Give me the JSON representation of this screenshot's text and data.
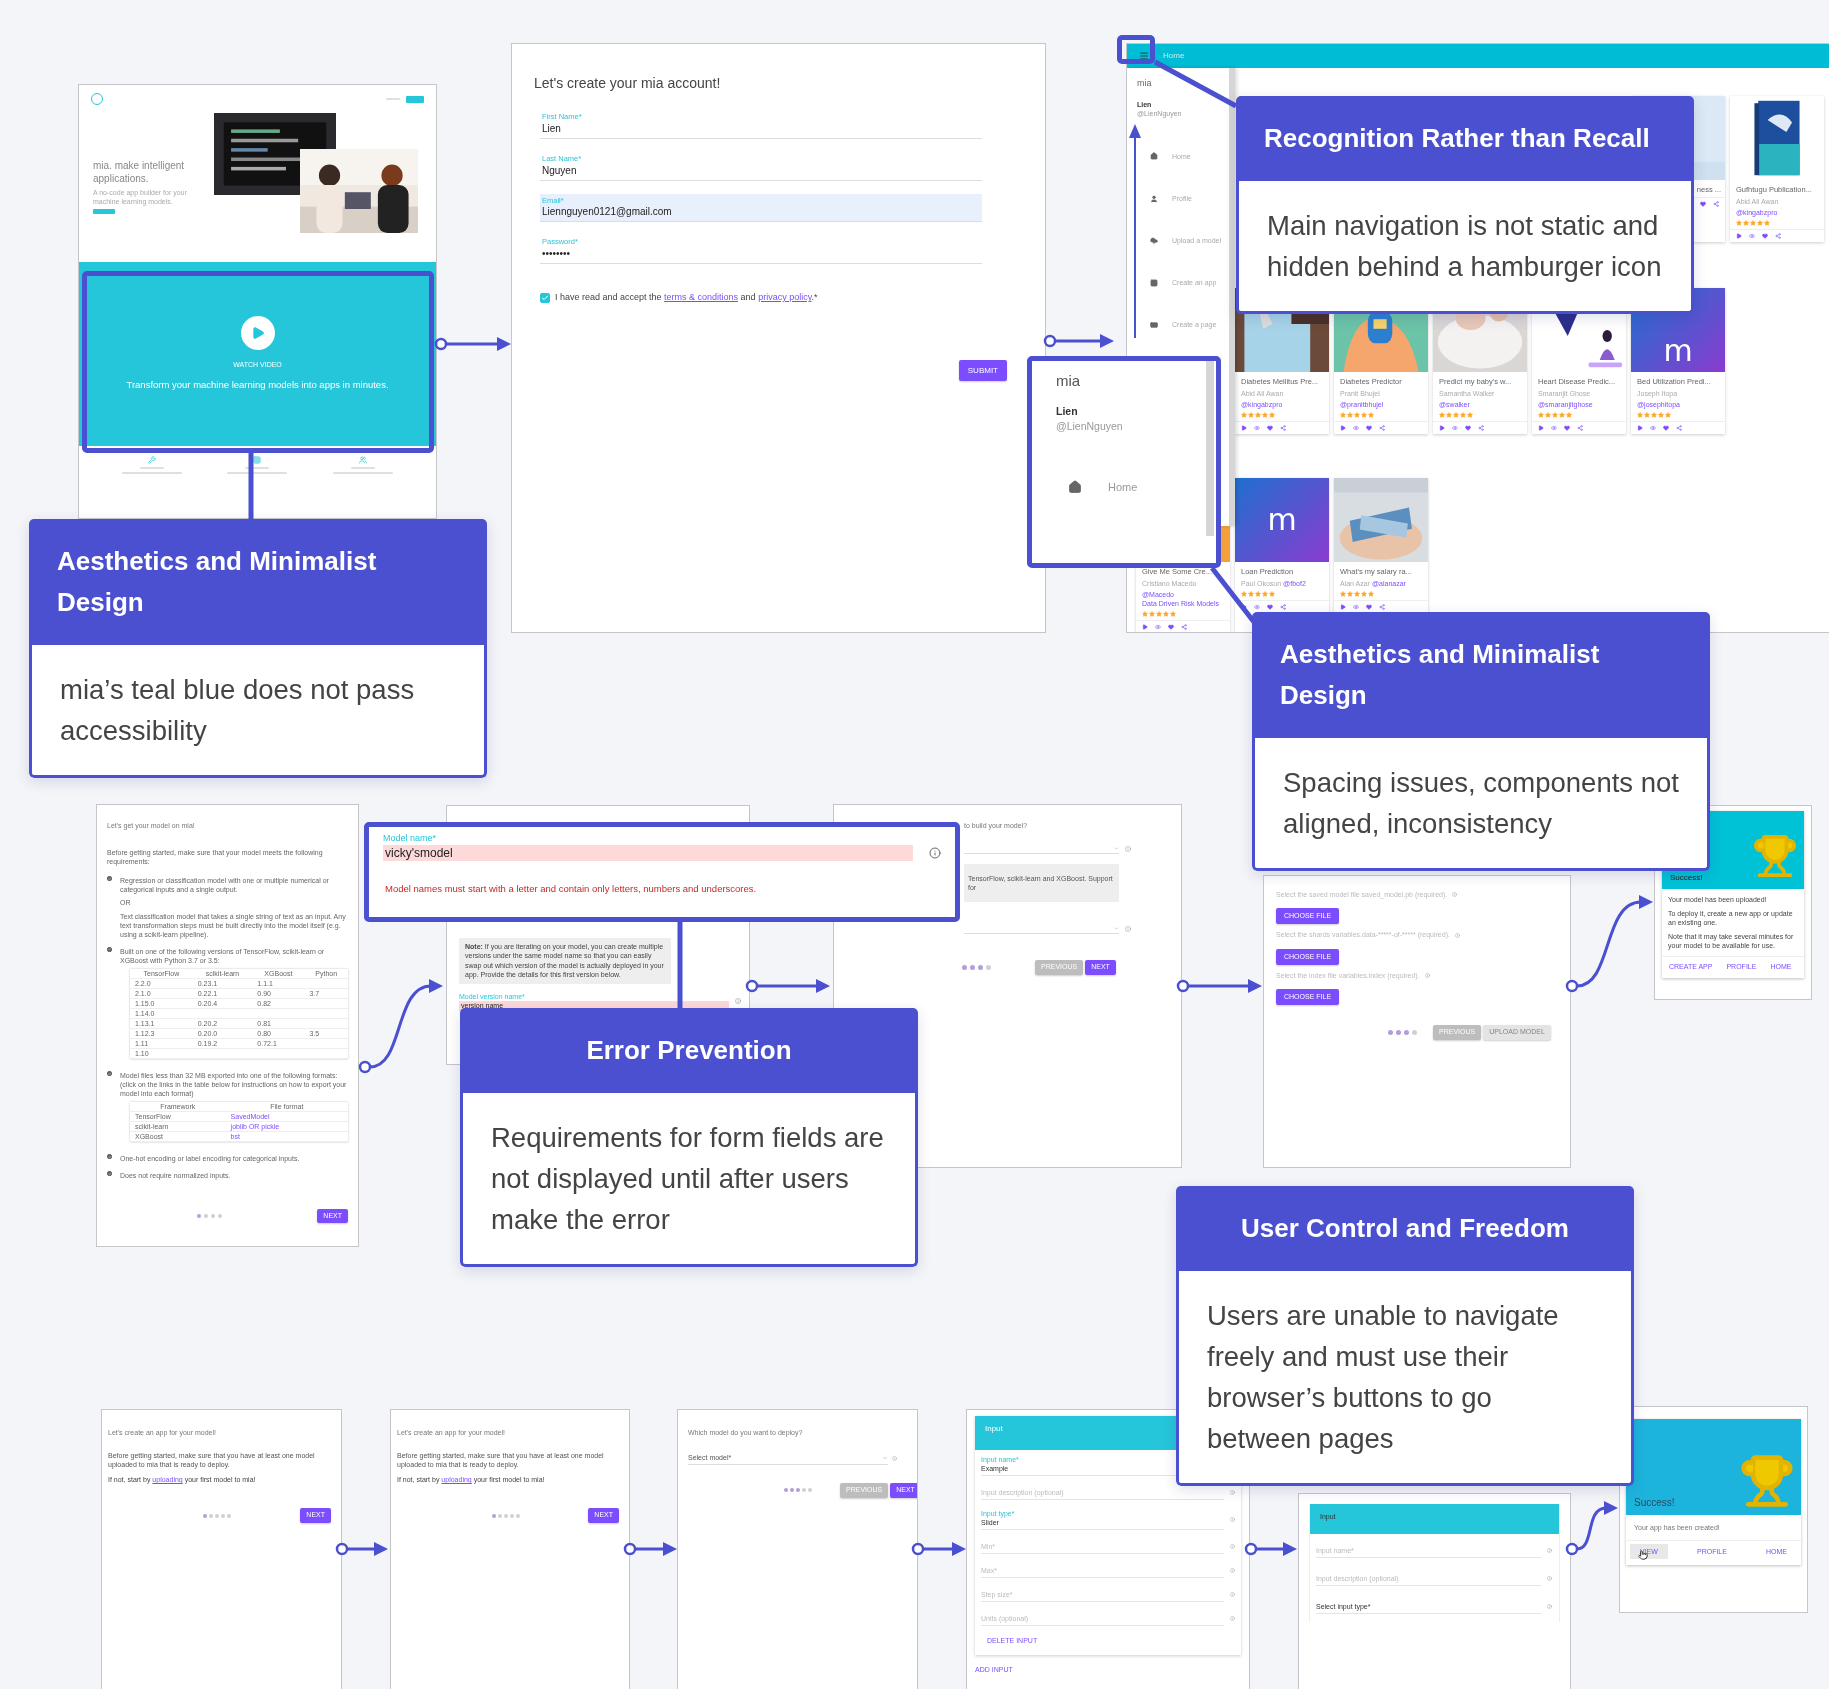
{
  "landing": {
    "headline": "mia. make intelligent applications.",
    "subline": "A no-code app builder for your machine learning models.",
    "video_label": "WATCH VIDEO",
    "video_caption": "Transform your machine learning models into apps in minutes."
  },
  "signup": {
    "title": "Let's create your mia account!",
    "fields": [
      {
        "label": "First Name*",
        "value": "Lien",
        "highlighted": false
      },
      {
        "label": "Last Name*",
        "value": "Nguyen",
        "highlighted": false
      },
      {
        "label": "Email*",
        "value": "Liennguyen0121@gmail.com",
        "highlighted": true
      },
      {
        "label": "Password*",
        "value": "••••••••",
        "highlighted": false
      }
    ],
    "consent": {
      "checked": true,
      "parts": [
        {
          "kind": "text",
          "text": "I have read and accept the "
        },
        {
          "kind": "link",
          "text": "terms & conditions"
        },
        {
          "kind": "text",
          "text": " and "
        },
        {
          "kind": "link",
          "text": "privacy policy"
        },
        {
          "kind": "text",
          "text": ".*"
        }
      ]
    },
    "submit": "SUBMIT"
  },
  "dashboard": {
    "page_title": "Home",
    "drawer": {
      "brand": "mia",
      "user_name": "Lien",
      "user_handle": "@LienNguyen",
      "items": [
        {
          "kind": "home",
          "label": "Home"
        },
        {
          "kind": "profile",
          "label": "Profile"
        },
        {
          "kind": "upload",
          "label": "Upload a model"
        },
        {
          "kind": "app",
          "label": "Create an app"
        },
        {
          "kind": "page",
          "label": "Create a page"
        }
      ]
    },
    "rows": [
      [
        "",
        "",
        "",
        "",
        "",
        {
          "kind": "picture",
          "title": "ness ..."
        },
        {
          "kind": "picture",
          "title": "Gufhtugu Publication...",
          "author": "Abid Ali Awan",
          "handle": "@kingabzpro",
          "stars": 5
        }
      ],
      [
        "",
        {
          "kind": "picture",
          "title": "Diabetes Mellitus Pre...",
          "author": "Abid Ali Awan",
          "handle": "@kingabzpro",
          "stars": 5
        },
        {
          "kind": "picture",
          "title": "Diabetes Predictor",
          "author": "Pranit Bhujel",
          "handle": "@pranitbhujel",
          "stars": 5
        },
        {
          "kind": "picture",
          "title": "Predict my baby's w...",
          "author": "Samantha Walker",
          "handle": "@swalker",
          "stars": 5
        },
        {
          "kind": "picture",
          "title": "Heart Disease Predic...",
          "author": "Smaranjit Ghose",
          "handle": "@smaranjitghose",
          "stars": 5
        },
        {
          "kind": "logo",
          "title": "Bed Utilization Predi...",
          "author": "Joseph Itopa",
          "handle": "@josephitopa",
          "logo_text": "m",
          "stars": 5
        }
      ],
      [
        {
          "kind": "picture",
          "title": "Give Me Some Cre...",
          "author": "Cristiano Macedo",
          "handle": "@Macedo",
          "extra": "Data Driven Risk Models",
          "stars": 5
        },
        {
          "kind": "logo",
          "title": "Loan Prediction",
          "author": "Paul Okosun",
          "handle": "@fbof2",
          "logo_text": "m",
          "stars": 5
        },
        {
          "kind": "picture",
          "title": "What's my salary ra...",
          "author": "Alan Azar",
          "handle": "@alanazar",
          "stars": 5
        }
      ]
    ]
  },
  "drawer_zoom": {
    "brand": "mia",
    "user_name": "Lien",
    "user_handle": "@LienNguyen",
    "item": "Home"
  },
  "upload_requirements": {
    "title": "Let's get your model on mia!",
    "intro": "Before getting started, make sure that your model meets the following requirements:",
    "items": [
      {
        "checked": true,
        "text": "Regression or classification model with one or multiple numerical or categorical inputs and a single output.",
        "or": "OR",
        "alt": "Text classification model that takes a single string of text as an input. Any text transformation steps must be built directly into the model itself (e.g. using a scikit-learn pipeline)."
      },
      {
        "checked": true,
        "text": "Built on one of the following versions of TensorFlow, scikit-learn or XGBoost with Python 3.7 or 3.5:",
        "table": {
          "columns": [
            "TensorFlow",
            "scikit-learn",
            "XGBoost",
            "Python"
          ],
          "rows": [
            [
              "2.2.0",
              "0.23.1",
              "1.1.1",
              ""
            ],
            [
              "2.1.0",
              "0.22.1",
              "0.90",
              "3.7"
            ],
            [
              "1.15.0",
              "0.20.4",
              "0.82",
              ""
            ],
            [
              "1.14.0",
              "",
              "",
              ""
            ],
            [
              "1.13.1",
              "0.20.2",
              "0.81",
              ""
            ],
            [
              "1.12.3",
              "0.20.0",
              "0.80",
              "3.5"
            ],
            [
              "1.11",
              "0.19.2",
              "0.72.1",
              ""
            ],
            [
              "1.10",
              "",
              "",
              ""
            ]
          ]
        }
      },
      {
        "checked": true,
        "text": "Model files less than 32 MB exported into one of the following formats: (click on the links in the table below for instructions on how to export your model into each format)",
        "table": {
          "columns": [
            "Framework",
            "File format"
          ],
          "rows": [
            [
              "TensorFlow",
              "SavedModel"
            ],
            [
              "scikit-learn",
              "joblib OR pickle"
            ],
            [
              "XGBoost",
              "bst"
            ]
          ]
        }
      },
      {
        "checked": true,
        "text": "One-hot encoding or label encoding for categorical inputs."
      },
      {
        "checked": true,
        "text": "Does not require normalized inputs."
      }
    ],
    "dots": [
      {
        "active": true
      },
      {
        "active": false
      },
      {
        "active": false
      },
      {
        "active": false
      }
    ],
    "next": "NEXT"
  },
  "model_name": {
    "note_label": "Note:",
    "note": "If you are iterating on your model, you can create multiple versions under the same model name so that you can easily swap out which version of the model is actually deployed in your app. Provide the details for this first version below.",
    "version_label": "Model version name*",
    "version_value": "version name",
    "version_error": true
  },
  "model_name_overlay": {
    "label": "Model name*",
    "value": "vicky'smodel",
    "error": "Model names must start with a letter and contain only letters, numbers and underscores.",
    "invalid": true
  },
  "framework_step": {
    "title": "to build your model?",
    "support_text": "TensorFlow, scikit-learn and XGBoost. Support for",
    "dots": [
      {
        "active": true
      },
      {
        "active": true
      },
      {
        "active": true
      },
      {
        "active": false
      }
    ],
    "buttons": [
      {
        "kind": "secondary",
        "label": "PREVIOUS"
      },
      {
        "kind": "primary",
        "label": "NEXT"
      }
    ]
  },
  "files_step": {
    "files": [
      {
        "label": "Select the saved model file saved_model.pb (required).",
        "button": "CHOOSE FILE"
      },
      {
        "label": "Select the shards variables.data-*****-of-***** (required).",
        "button": "CHOOSE FILE"
      },
      {
        "label": "Select the index file variables.index (required).",
        "button": "CHOOSE FILE"
      }
    ],
    "dots": [
      {
        "active": true
      },
      {
        "active": true
      },
      {
        "active": true
      },
      {
        "active": false
      }
    ],
    "buttons": [
      {
        "kind": "secondary",
        "label": "PREVIOUS"
      },
      {
        "kind": "disabled",
        "label": "UPLOAD MODEL"
      }
    ]
  },
  "upload_success": {
    "title": "Success!",
    "lines": [
      "Your model has been uploaded!",
      "To deploy it, create a new app or update an existing one.",
      "Note that it may take several minutes for your model to be available for use."
    ],
    "actions": [
      "CREATE APP",
      "PROFILE",
      "HOME"
    ]
  },
  "app_intros": [
    {
      "title": "Let's create an app for your model!",
      "text": "Before getting started, make sure that you have at least one model uploaded to mia that is ready to deploy.",
      "parts": [
        {
          "kind": "text",
          "text": "If not, start by "
        },
        {
          "kind": "link",
          "text": "uploading"
        },
        {
          "kind": "text",
          "text": " your first model to mia!"
        }
      ],
      "dots": [
        {
          "active": true
        },
        {
          "active": false
        },
        {
          "active": false
        },
        {
          "active": false
        },
        {
          "active": false
        }
      ],
      "next": "NEXT"
    },
    {
      "title": "Let's create an app for your model!",
      "text": "Before getting started, make sure that you have at least one model uploaded to mia that is ready to deploy.",
      "parts": [
        {
          "kind": "text",
          "text": "If not, start by "
        },
        {
          "kind": "link",
          "text": "uploading"
        },
        {
          "kind": "text",
          "text": " your first model to mia!"
        }
      ],
      "dots": [
        {
          "active": true
        },
        {
          "active": false
        },
        {
          "active": false
        },
        {
          "active": false
        },
        {
          "active": false
        }
      ],
      "next": "NEXT"
    }
  ],
  "deploy_step": {
    "title": "Which model do you want to deploy?",
    "select": "Select model*",
    "dots": [
      {
        "active": true
      },
      {
        "active": true
      },
      {
        "active": true
      },
      {
        "active": false
      },
      {
        "active": false
      }
    ],
    "buttons": [
      {
        "kind": "secondary",
        "label": "PREVIOUS"
      },
      {
        "kind": "primary",
        "label": "NEXT"
      }
    ]
  },
  "input_step_1": {
    "header": "Input",
    "fields": [
      {
        "label": "Input name*",
        "value": "Example"
      },
      {
        "placeholder": "Input description (optional)"
      },
      {
        "label": "Input type*",
        "value": "Slider"
      },
      {
        "placeholder": "Min*"
      },
      {
        "placeholder": "Max*"
      },
      {
        "placeholder": "Step size*"
      },
      {
        "placeholder": "Units (optional)"
      }
    ],
    "delete": "DELETE INPUT",
    "add": "ADD INPUT"
  },
  "input_step_2": {
    "header": "Input",
    "fields": [
      {
        "placeholder": "Input name*"
      },
      {
        "placeholder": "Input description (optional)"
      },
      {
        "value": "Select input type*"
      }
    ]
  },
  "app_success": {
    "title": "Success!",
    "text": "Your app has been created!",
    "actions": [
      {
        "label": "VIEW",
        "hovered": true
      },
      {
        "label": "PROFILE",
        "hovered": false
      },
      {
        "label": "HOME",
        "hovered": false
      }
    ]
  },
  "callouts": [
    {
      "title": "Aesthetics and Minimalist Design",
      "text": "mia’s teal blue does not pass accessibility"
    },
    {
      "title": "Recognition Rather than Recall",
      "text": "Main navigation is not static and hidden behind a hamburger icon"
    },
    {
      "title": "Aesthetics and Minimalist Design",
      "text": "Spacing issues, components not aligned, inconsistency"
    },
    {
      "title": "Error Prevention",
      "text": "Requirements for form fields are not displayed until after users make the error"
    },
    {
      "title": "User Control and Freedom",
      "text": "Users are unable to navigate freely and must use their browser’s buttons to go between pages"
    }
  ]
}
